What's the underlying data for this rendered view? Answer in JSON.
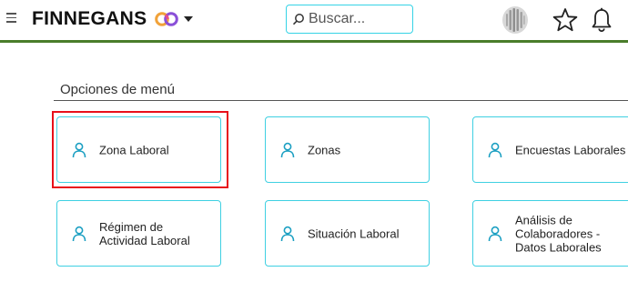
{
  "header": {
    "brand": "FINNEGANS",
    "search_placeholder": "Buscar...",
    "menu_icon": "hamburger-icon",
    "favorites_icon": "star-icon",
    "notifications_icon": "bell-icon",
    "accent_color": "#4a7d2a",
    "border_color": "#35d3e6"
  },
  "menu_section": {
    "title": "Opciones de menú",
    "items": [
      {
        "label": "Zona Laboral",
        "icon": "person-icon",
        "selected": true
      },
      {
        "label": "Zonas",
        "icon": "person-icon"
      },
      {
        "label": "Encuestas Laborales",
        "icon": "person-icon"
      },
      {
        "label": "Régimen de Actividad Laboral",
        "icon": "person-icon"
      },
      {
        "label": "Situación Laboral",
        "icon": "person-icon"
      },
      {
        "label": "Análisis de Colaboradores - Datos Laborales",
        "icon": "person-icon"
      }
    ]
  },
  "highlight_color": "#e8101a"
}
